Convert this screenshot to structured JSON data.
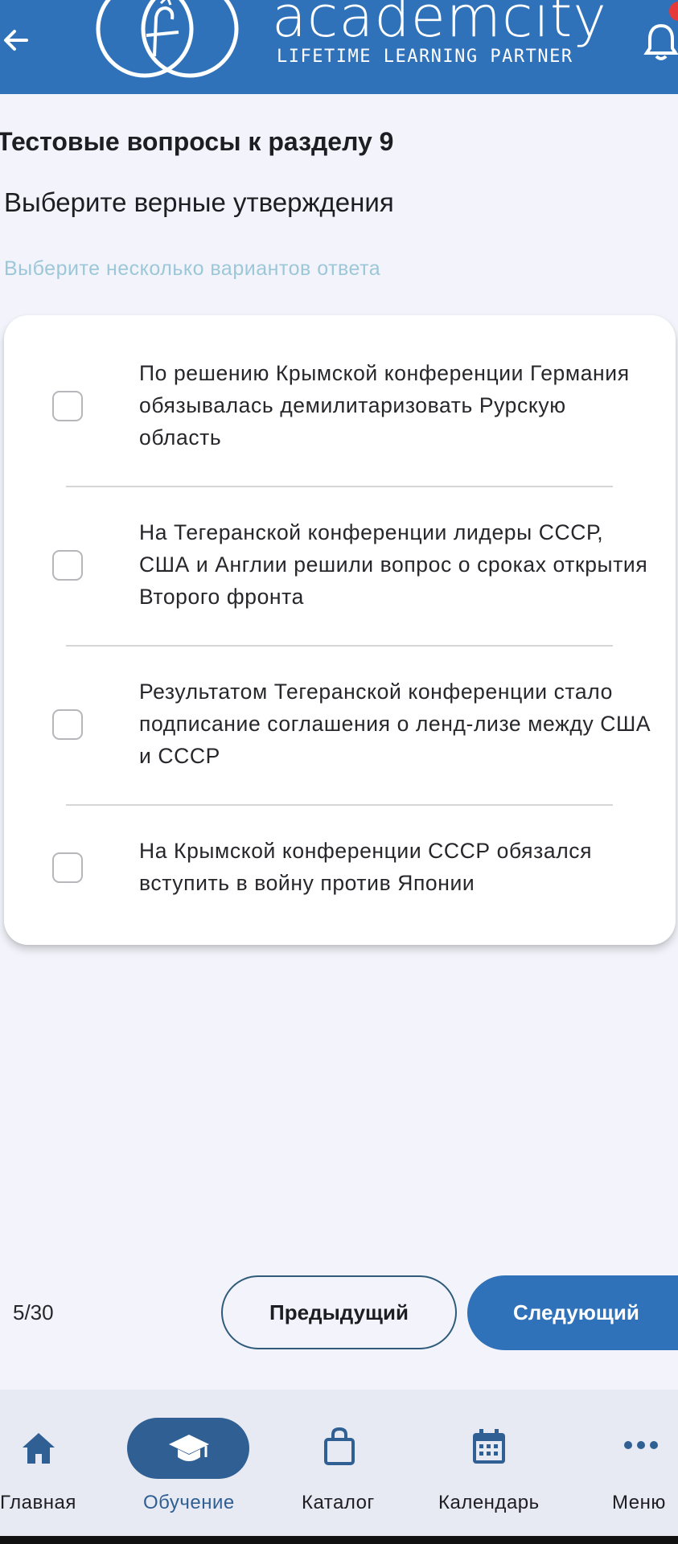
{
  "header": {
    "brand_name": "academcity",
    "tagline": "LIFETIME LEARNING PARTNER",
    "icons": {
      "back": "arrow-left-icon",
      "logo": "academcity-logo-icon",
      "notifications": "bell-icon"
    },
    "colors": {
      "header_bg": "#2f72ba",
      "badge": "#e5393a"
    }
  },
  "quiz": {
    "section_title": "Тестовые вопросы к разделу 9",
    "question": "Выберите верные утверждения",
    "hint": "Выберите несколько вариантов ответа",
    "options": [
      {
        "text": "По решению Крымской конференции Германия обязывалась демилитаризовать Рурскую область",
        "checked": false
      },
      {
        "text": "На Тегеранской конференции лидеры СССР, США и Англии решили вопрос о сроках открытия Второго фронта",
        "checked": false
      },
      {
        "text": "Результатом Тегеранской конференции стало подписание соглашения о ленд-лизе между США и СССР",
        "checked": false
      },
      {
        "text": "На Крымской конференции СССР обязался вступить в войну против Японии",
        "checked": false
      }
    ]
  },
  "pagination": {
    "counter": "5/30",
    "prev_label": "Предыдущий",
    "next_label": "Следующий"
  },
  "nav": {
    "items": [
      {
        "label": "Главная",
        "icon": "home-icon",
        "active": false
      },
      {
        "label": "Обучение",
        "icon": "graduation-cap-icon",
        "active": true
      },
      {
        "label": "Каталог",
        "icon": "shopping-bag-icon",
        "active": false
      },
      {
        "label": "Календарь",
        "icon": "calendar-icon",
        "active": false
      },
      {
        "label": "Меню",
        "icon": "more-horizontal-icon",
        "active": false
      }
    ],
    "colors": {
      "active": "#2f5f93",
      "background": "#e8eaf3"
    }
  }
}
